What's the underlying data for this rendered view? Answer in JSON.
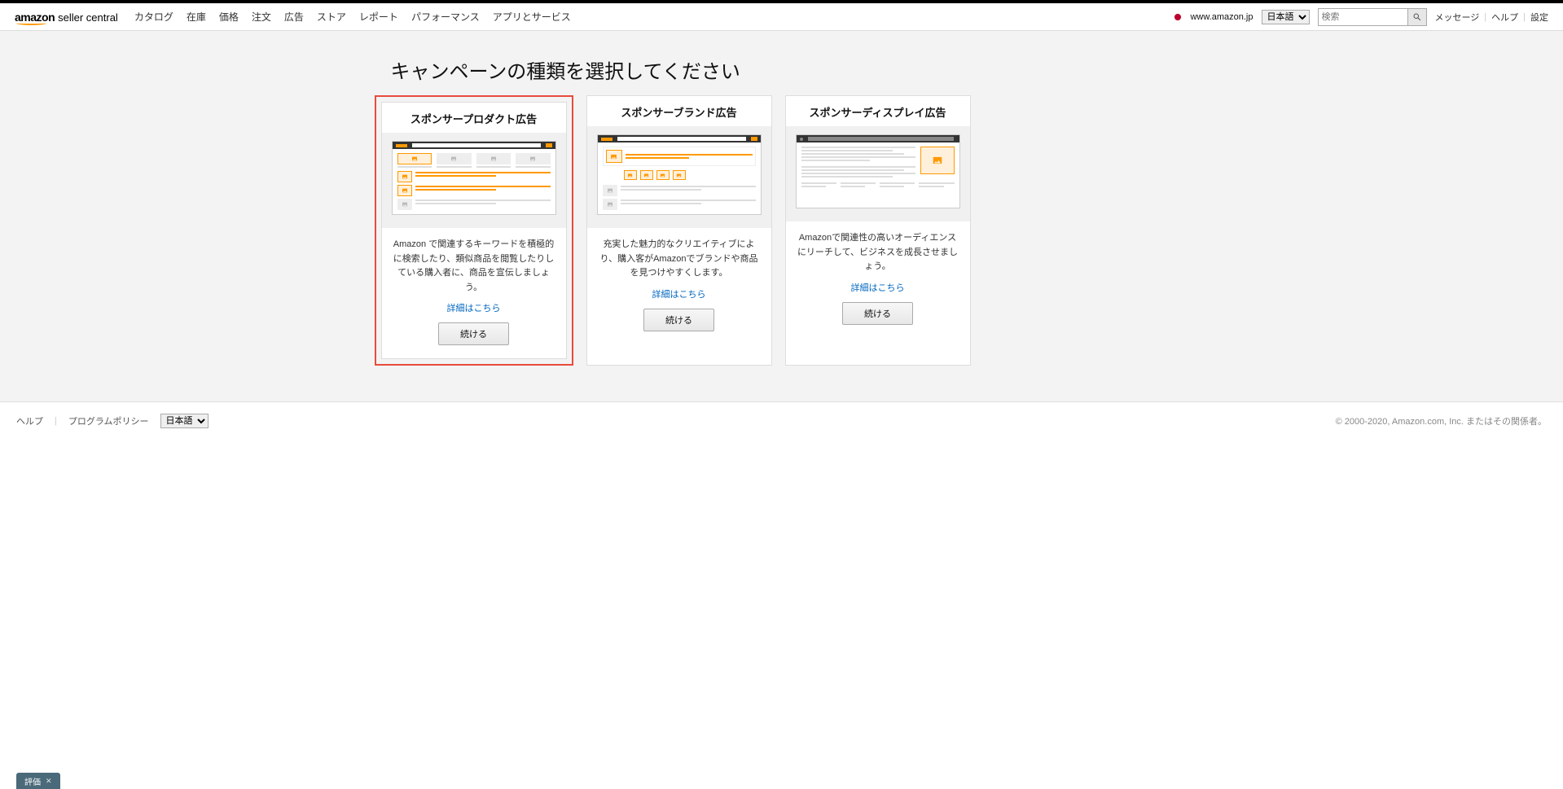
{
  "header": {
    "logo_amazon": "amazon",
    "logo_sc": "seller central",
    "nav": [
      "カタログ",
      "在庫",
      "価格",
      "注文",
      "広告",
      "ストア",
      "レポート",
      "パフォーマンス",
      "アプリとサービス"
    ],
    "marketplace": "www.amazon.jp",
    "lang_selected": "日本語",
    "search_placeholder": "検索",
    "links": {
      "messages": "メッセージ",
      "help": "ヘルプ",
      "settings": "設定"
    }
  },
  "page": {
    "title": "キャンペーンの種類を選択してください",
    "cards": [
      {
        "title": "スポンサープロダクト広告",
        "desc": "Amazon で関連するキーワードを積極的に検索したり、類似商品を閲覧したりしている購入者に、商品を宣伝しましょう。",
        "link": "詳細はこちら",
        "button": "続ける"
      },
      {
        "title": "スポンサーブランド広告",
        "desc": "充実した魅力的なクリエイティブにより、購入客がAmazonでブランドや商品を見つけやすくします。",
        "link": "詳細はこちら",
        "button": "続ける"
      },
      {
        "title": "スポンサーディスプレイ広告",
        "desc": "Amazonで関連性の高いオーディエンスにリーチして、ビジネスを成長させましょう。",
        "link": "詳細はこちら",
        "button": "続ける"
      }
    ]
  },
  "footer": {
    "help": "ヘルプ",
    "policy": "プログラムポリシー",
    "lang_selected": "日本語",
    "copyright": "© 2000-2020, Amazon.com, Inc. またはその関係者。"
  },
  "feedback": {
    "label": "評価",
    "close": "✕"
  }
}
